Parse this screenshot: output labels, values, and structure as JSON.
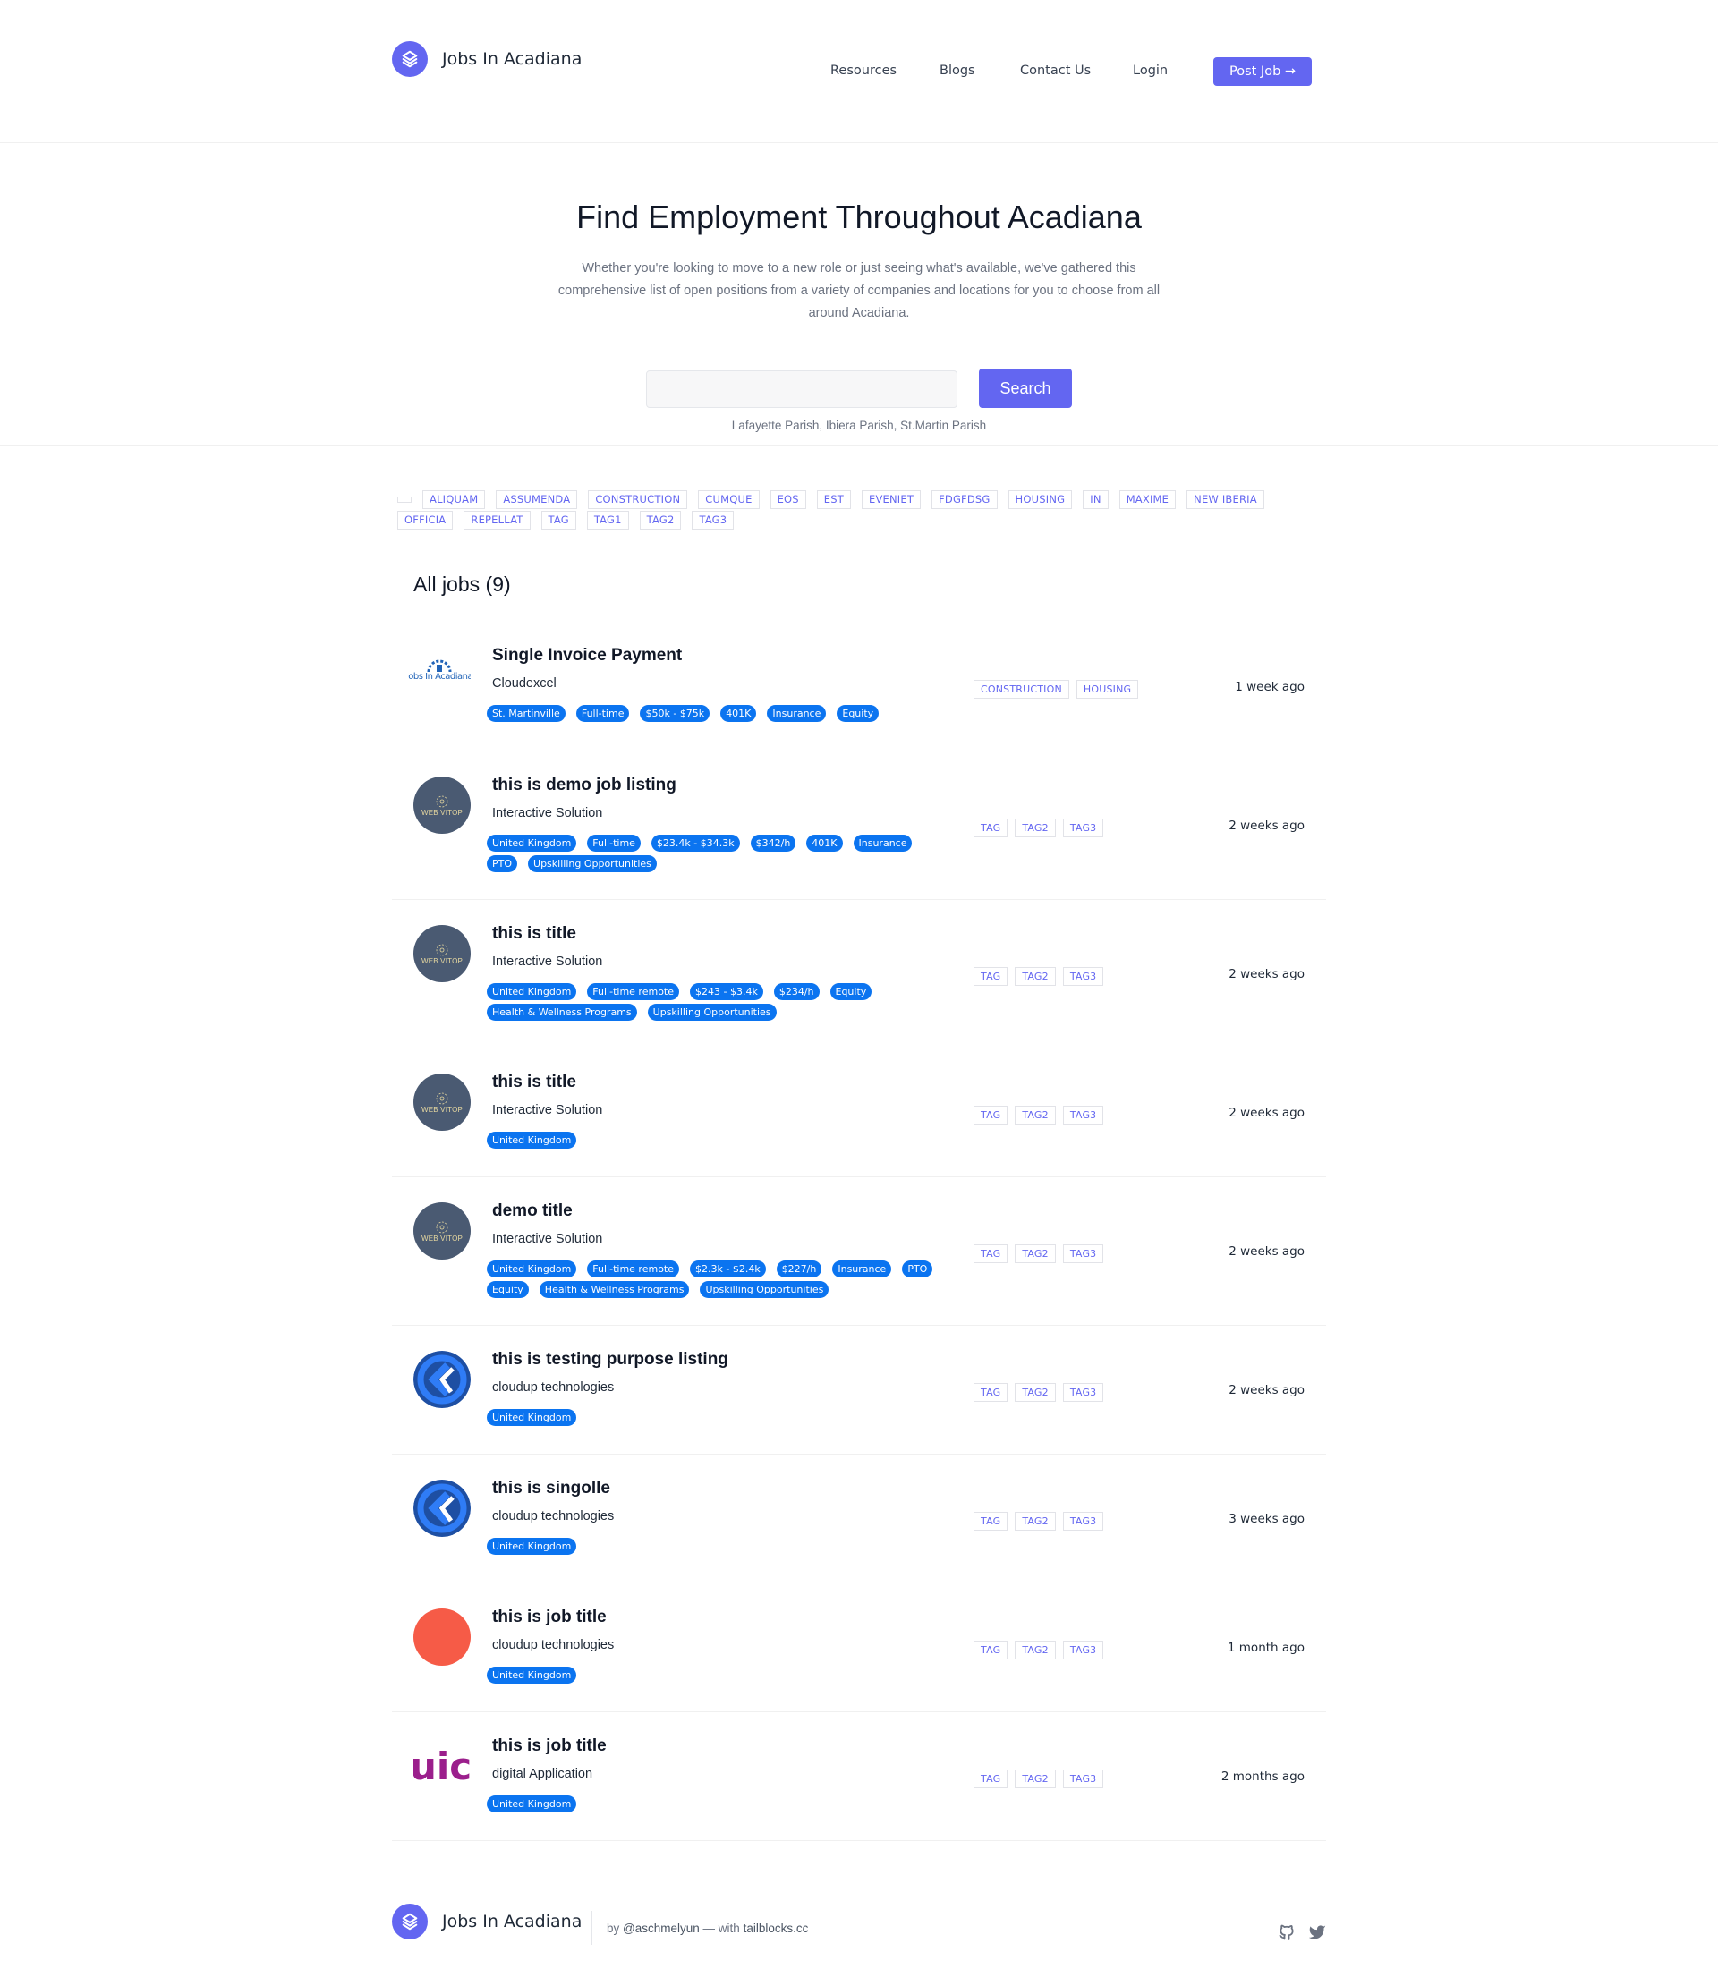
{
  "header": {
    "brand": "Jobs In Acadiana",
    "nav": [
      "Resources",
      "Blogs",
      "Contact Us",
      "Login"
    ],
    "post_job": "Post Job →"
  },
  "hero": {
    "title": "Find Employment Throughout Acadiana",
    "lead": "Whether you're looking to move to a new role or just seeing what's available, we've gathered this comprehensive list of open positions from a variety of companies and locations for you to choose from all around Acadiana.",
    "search_value": "",
    "search_placeholder": "",
    "search_button": "Search",
    "parishes": "Lafayette Parish, Ibiera Parish, St.Martin Parish"
  },
  "tag_filter": [
    "",
    "ALIQUAM",
    "ASSUMENDA",
    "CONSTRUCTION",
    "CUMQUE",
    "EOS",
    "EST",
    "EVENIET",
    "FDGFDSG",
    "HOUSING",
    "IN",
    "MAXIME",
    "NEW IBERIA",
    "OFFICIA",
    "REPELLAT",
    "TAG",
    "TAG1",
    "TAG2",
    "TAG3"
  ],
  "jobs": {
    "heading": "All jobs (9)",
    "items": [
      {
        "title": "Single Invoice Payment",
        "company": "Cloudexcel",
        "logo": "jobs-in-acadiana-logo",
        "pills": [
          "St. Martinville",
          "Full-time",
          "$50k - $75k",
          "401K",
          "Insurance",
          "Equity"
        ],
        "tags": [
          "CONSTRUCTION",
          "HOUSING"
        ],
        "time": "1 week ago"
      },
      {
        "title": "this is demo job listing",
        "company": "Interactive Solution",
        "logo": "web-vitop-logo",
        "pills": [
          "United Kingdom",
          "Full-time",
          "$23.4k - $34.3k",
          "$342/h",
          "401K",
          "Insurance",
          "PTO",
          "Upskilling Opportunities"
        ],
        "tags": [
          "TAG",
          "TAG2",
          "TAG3"
        ],
        "time": "2 weeks ago"
      },
      {
        "title": "this is title",
        "company": "Interactive Solution",
        "logo": "web-vitop-logo",
        "pills": [
          "United Kingdom",
          "Full-time remote",
          "$243 - $3.4k",
          "$234/h",
          "Equity",
          "Health & Wellness Programs",
          "Upskilling Opportunities"
        ],
        "tags": [
          "TAG",
          "TAG2",
          "TAG3"
        ],
        "time": "2 weeks ago"
      },
      {
        "title": "this is title",
        "company": "Interactive Solution",
        "logo": "web-vitop-logo",
        "pills": [
          "United Kingdom"
        ],
        "tags": [
          "TAG",
          "TAG2",
          "TAG3"
        ],
        "time": "2 weeks ago"
      },
      {
        "title": "demo title",
        "company": "Interactive Solution",
        "logo": "web-vitop-logo",
        "pills": [
          "United Kingdom",
          "Full-time remote",
          "$2.3k - $2.4k",
          "$227/h",
          "Insurance",
          "PTO",
          "Equity",
          "Health & Wellness Programs",
          "Upskilling Opportunities"
        ],
        "tags": [
          "TAG",
          "TAG2",
          "TAG3"
        ],
        "time": "2 weeks ago"
      },
      {
        "title": "this is testing purpose listing",
        "company": "cloudup technologies",
        "logo": "cloudup-logo",
        "pills": [
          "United Kingdom"
        ],
        "tags": [
          "TAG",
          "TAG2",
          "TAG3"
        ],
        "time": "2 weeks ago"
      },
      {
        "title": "this is singolle",
        "company": "cloudup technologies",
        "logo": "cloudup-logo",
        "pills": [
          "United Kingdom"
        ],
        "tags": [
          "TAG",
          "TAG2",
          "TAG3"
        ],
        "time": "3 weeks ago"
      },
      {
        "title": "this is job title",
        "company": "cloudup technologies",
        "logo": "red-circle-logo",
        "pills": [
          "United Kingdom"
        ],
        "tags": [
          "TAG",
          "TAG2",
          "TAG3"
        ],
        "time": "1 month ago"
      },
      {
        "title": "this is job title",
        "company": "digital Application",
        "logo": "uic-logo",
        "pills": [
          "United Kingdom"
        ],
        "tags": [
          "TAG",
          "TAG2",
          "TAG3"
        ],
        "time": "2 months ago"
      }
    ]
  },
  "logo_text": {
    "web_vitop": "WEB VITOP",
    "jobs_in_acadiana": "Jobs In Acadiana",
    "uic": "uic"
  },
  "footer": {
    "brand": "Jobs In Acadiana",
    "by": "by",
    "author": "@aschmelyun",
    "with": "— with",
    "site": "tailblocks.cc",
    "icons": [
      "github-icon",
      "twitter-icon"
    ]
  },
  "colors": {
    "accent": "#6366f1",
    "pill": "#0b74f0",
    "tag_text": "#6366f1"
  }
}
